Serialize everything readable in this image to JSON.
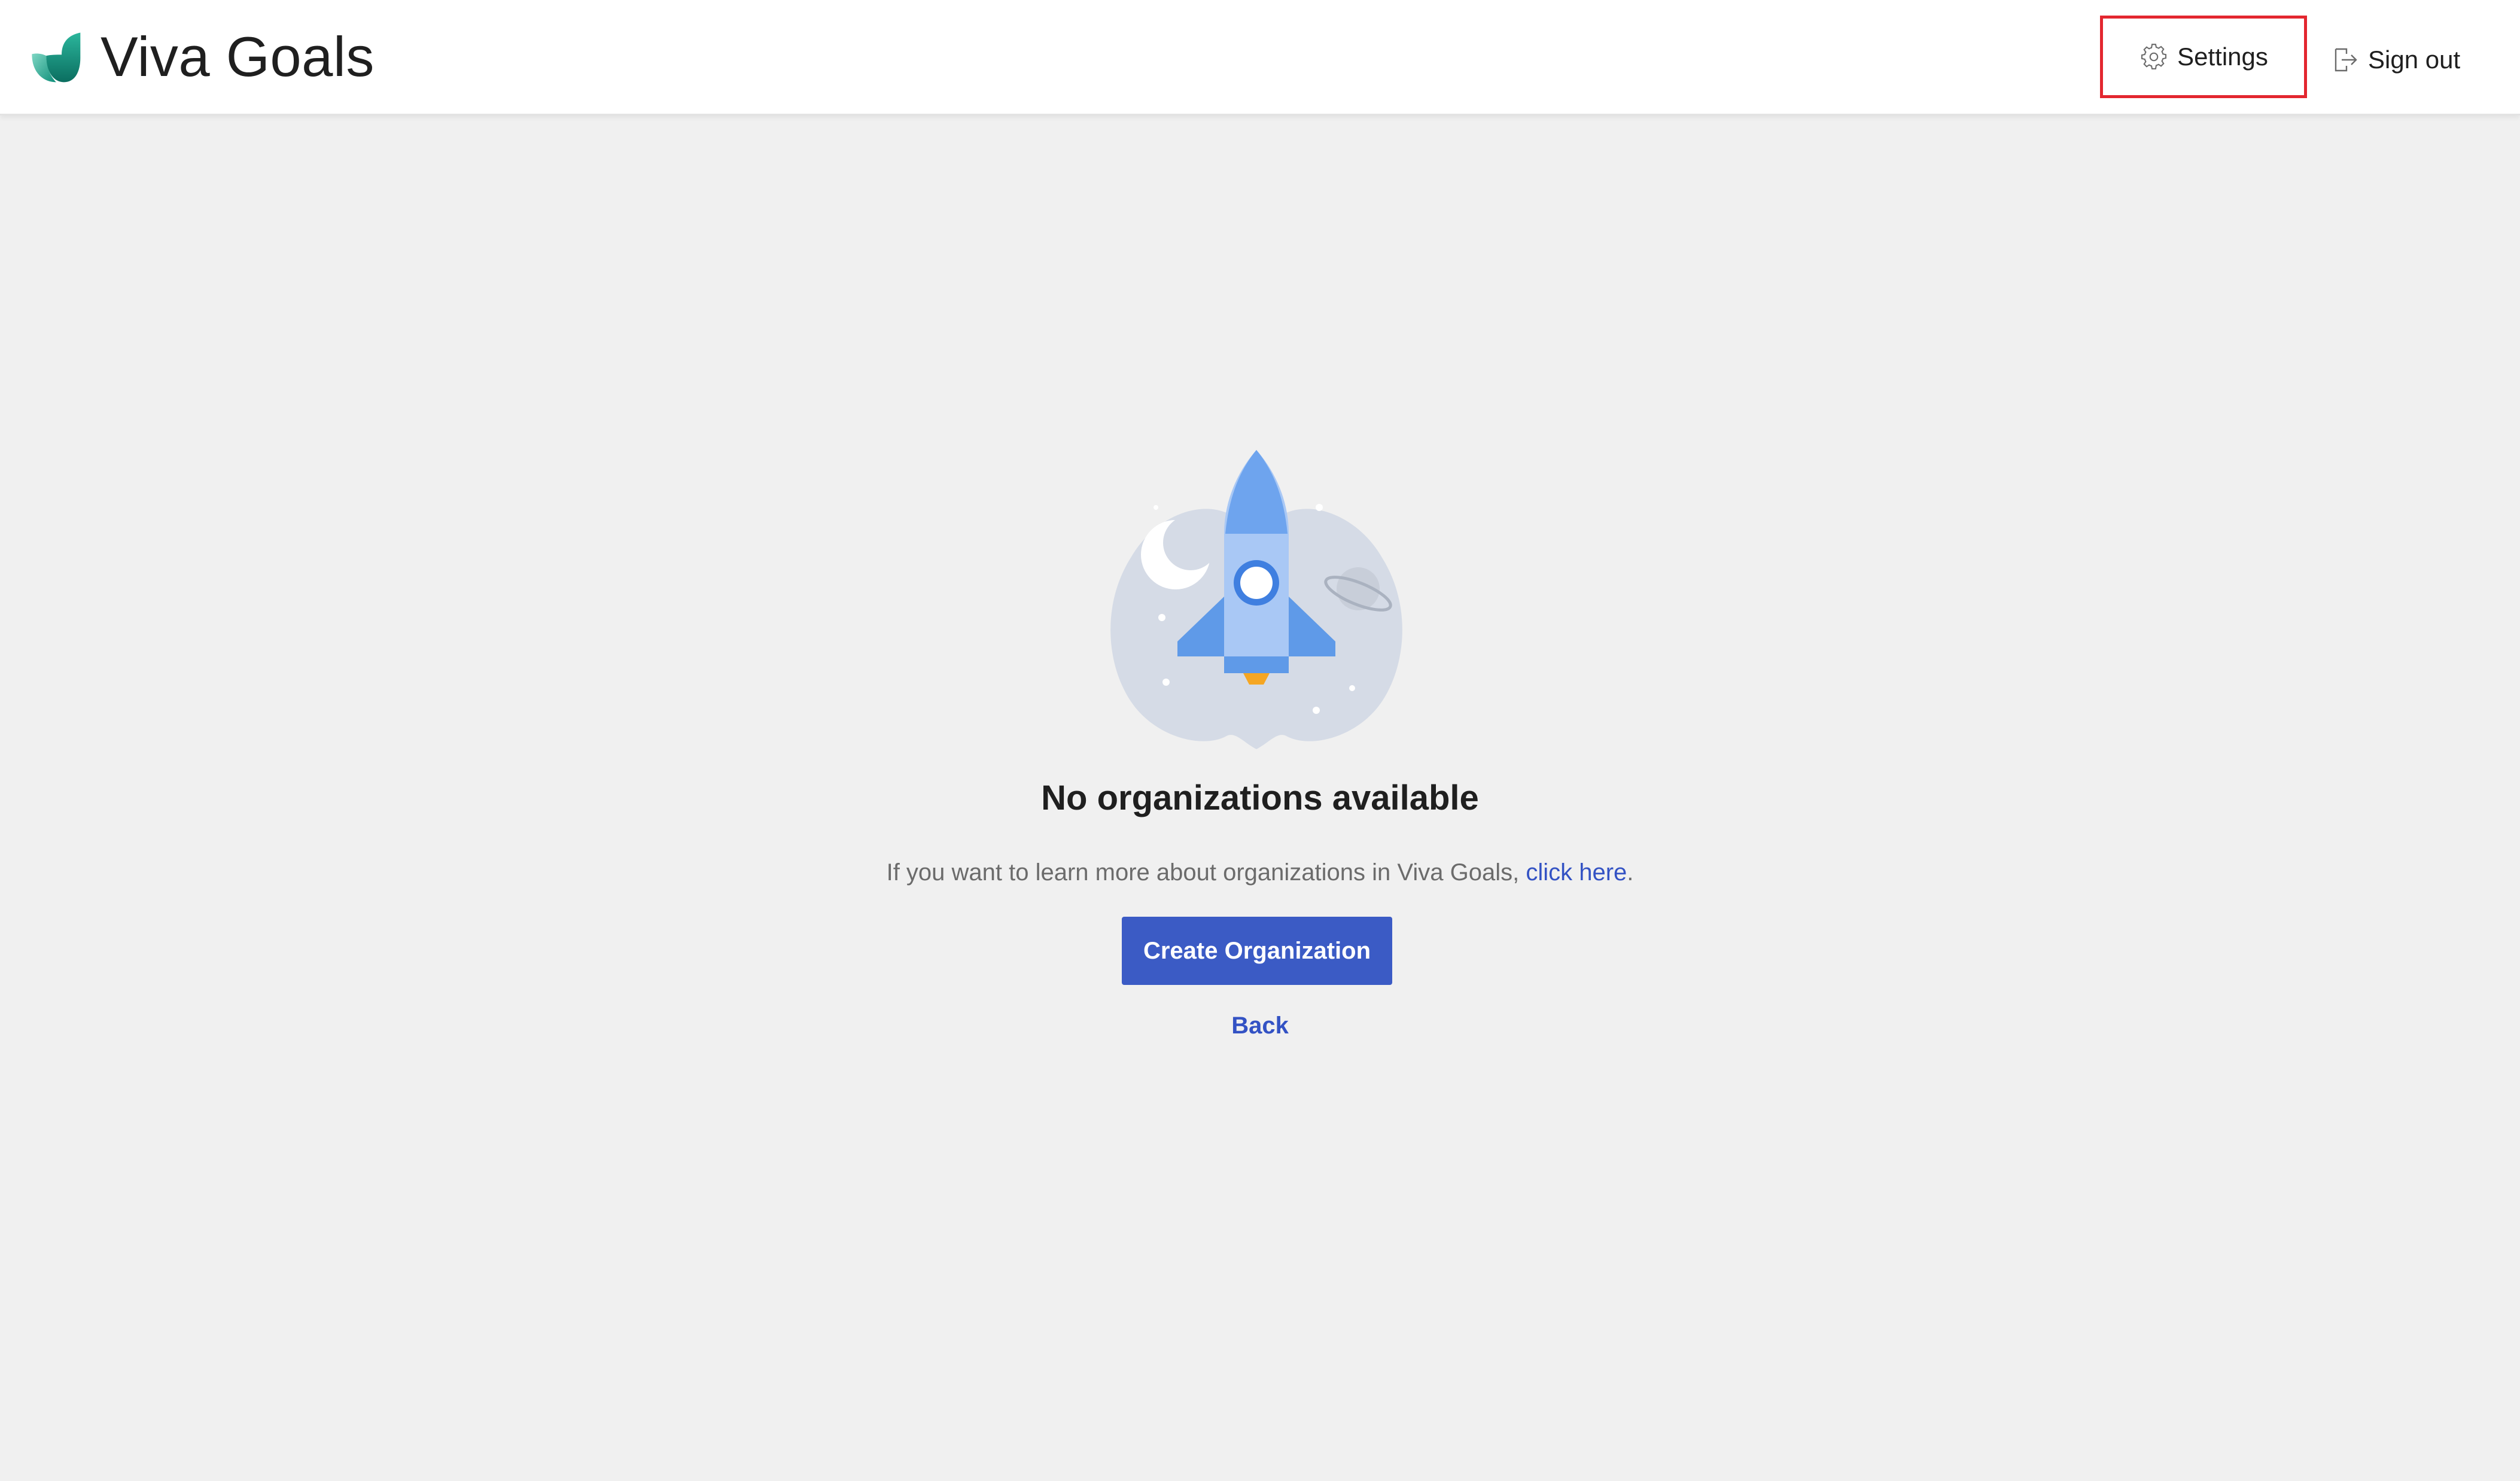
{
  "app": {
    "title": "Viva Goals"
  },
  "header": {
    "settings_label": "Settings",
    "signout_label": "Sign out",
    "icons": {
      "logo": "viva-goals-logo-icon",
      "settings": "gear-icon",
      "signout": "sign-out-icon"
    }
  },
  "empty_state": {
    "title": "No organizations available",
    "description_prefix": "If you want to learn more about organizations in Viva Goals, ",
    "description_link": "click here",
    "description_suffix": ".",
    "create_button_label": "Create Organization",
    "back_label": "Back",
    "illustration": "rocket-illustration"
  },
  "colors": {
    "primary": "#3b5bc5",
    "link": "#3352c4",
    "highlight_border": "#e3262f",
    "background": "#f0f0f0",
    "brand_teal": "#1ba28c"
  }
}
